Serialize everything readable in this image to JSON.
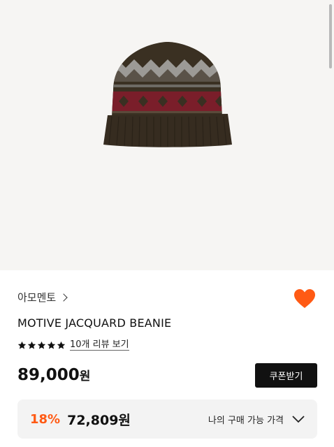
{
  "product": {
    "brand": "아모멘토",
    "name": "MOTIVE JACQUARD BEANIE",
    "rating_stars": 5,
    "review_link": "10개 리뷰 보기",
    "price": "89,000",
    "currency": "원",
    "coupon_button": "쿠폰받기"
  },
  "my_price": {
    "discount": "18%",
    "price": "72,809",
    "currency": "원",
    "label": "나의 구매 가능 가격"
  },
  "colors": {
    "accent": "#ff5a14",
    "heart": "#ff5a14",
    "button_bg": "#111111"
  },
  "icons": [
    "chevron-right-icon",
    "heart-icon",
    "star-icon",
    "chevron-down-icon"
  ]
}
